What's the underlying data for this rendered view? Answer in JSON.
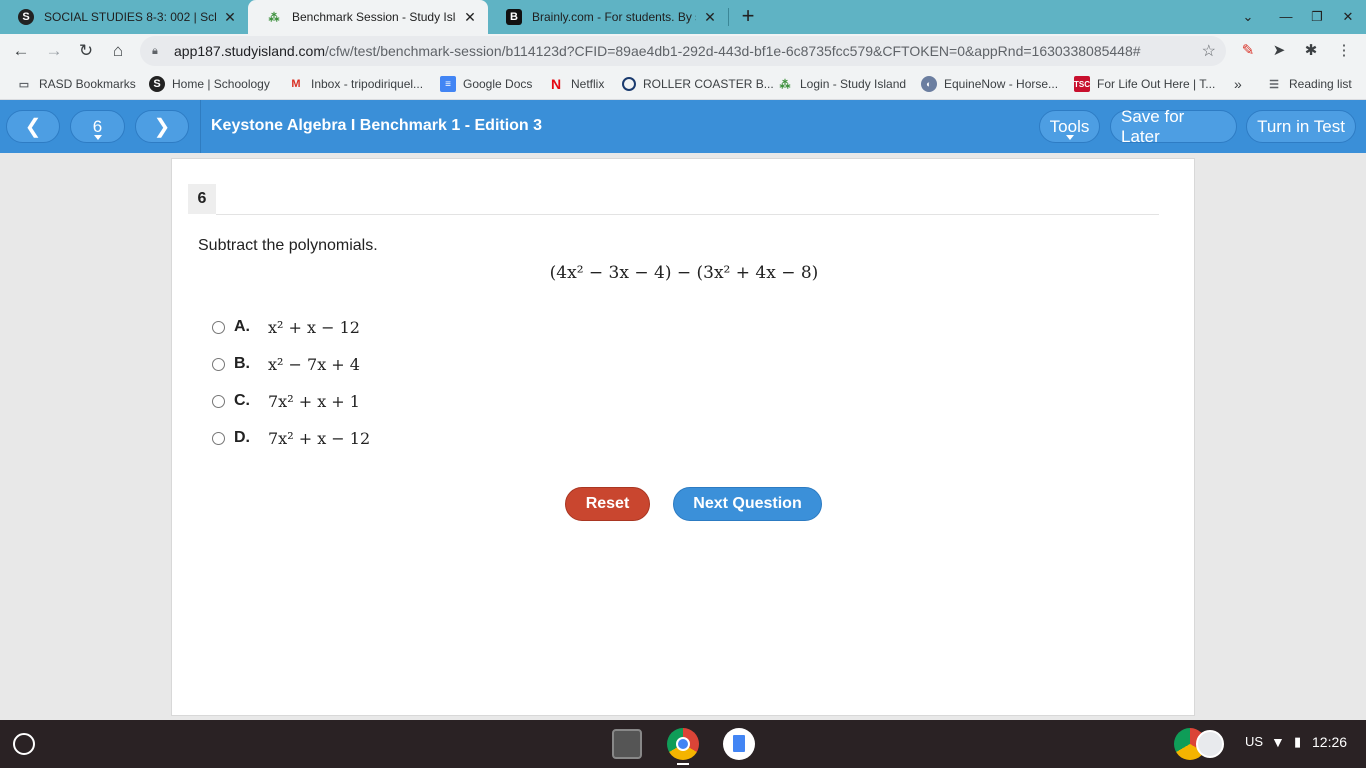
{
  "browser": {
    "tabs": [
      {
        "title": "SOCIAL STUDIES 8-3: 002 | Scho",
        "favicon": "S",
        "active": false
      },
      {
        "title": "Benchmark Session - Study Islan",
        "favicon": "⁂",
        "active": true
      },
      {
        "title": "Brainly.com - For students. By st",
        "favicon": "B",
        "active": false
      }
    ],
    "url_host": "app187.studyisland.com",
    "url_path": "/cfw/test/benchmark-session/b114123d?CFID=89ae4db1-292d-443d-bf1e-6c8735fcc579&CFTOKEN=0&appRnd=1630338085448#",
    "bookmarks": [
      {
        "label": "RASD Bookmarks",
        "icon": "folder-icon"
      },
      {
        "label": "Home | Schoology",
        "icon": "schoology-icon"
      },
      {
        "label": "Inbox - tripodiriquel...",
        "icon": "gmail-icon"
      },
      {
        "label": "Google Docs",
        "icon": "docs-icon"
      },
      {
        "label": "Netflix",
        "icon": "netflix-icon"
      },
      {
        "label": "ROLLER COASTER B...",
        "icon": "site-icon"
      },
      {
        "label": "Login - Study Island",
        "icon": "studyisland-icon"
      },
      {
        "label": "EquineNow - Horse...",
        "icon": "equine-icon"
      },
      {
        "label": "For Life Out Here | T...",
        "icon": "tsc-icon"
      }
    ],
    "bookmarks_overflow": "»",
    "reading_list": "Reading list"
  },
  "app": {
    "question_number": "6",
    "title": "Keystone Algebra I Benchmark 1 - Edition 3",
    "tools_label": "Tools",
    "save_label": "Save for Later",
    "turn_in_label": "Turn in Test",
    "accent": "#3a8fd8"
  },
  "question": {
    "number": "6",
    "prompt": "Subtract the polynomials.",
    "expression": "(4x² − 3x − 4) − (3x² + 4x − 8)",
    "choices": [
      {
        "letter": "A.",
        "text": "x² + x − 12"
      },
      {
        "letter": "B.",
        "text": "x² − 7x + 4"
      },
      {
        "letter": "C.",
        "text": "7x² + x + 1"
      },
      {
        "letter": "D.",
        "text": "7x² + x − 12"
      }
    ],
    "reset_label": "Reset",
    "next_label": "Next Question"
  },
  "system": {
    "locale": "US",
    "time": "12:26"
  }
}
